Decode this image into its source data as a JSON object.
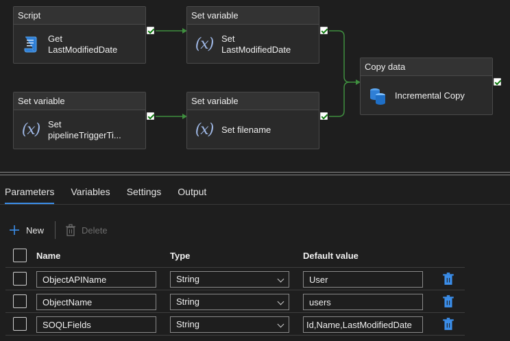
{
  "canvas": {
    "activities": [
      {
        "id": "script",
        "header": "Script",
        "label": "Get\nLastModifiedDate",
        "icon": "script-icon"
      },
      {
        "id": "setvar1",
        "header": "Set variable",
        "label": "Set\nLastModifiedDate",
        "icon": "variable-icon"
      },
      {
        "id": "setvar2",
        "header": "Set variable",
        "label": "Set\npipelineTriggerTi...",
        "icon": "variable-icon"
      },
      {
        "id": "setvar3",
        "header": "Set variable",
        "label": "Set filename",
        "icon": "variable-icon"
      },
      {
        "id": "copy",
        "header": "Copy data",
        "label": "Incremental Copy",
        "icon": "copy-data-icon"
      }
    ],
    "success_color": "#3f8f3f",
    "variable_glyph": "(𝑥)"
  },
  "tabs": [
    {
      "label": "Parameters",
      "active": true
    },
    {
      "label": "Variables",
      "active": false
    },
    {
      "label": "Settings",
      "active": false
    },
    {
      "label": "Output",
      "active": false
    }
  ],
  "toolbar": {
    "new_label": "New",
    "delete_label": "Delete"
  },
  "table": {
    "headers": {
      "name": "Name",
      "type": "Type",
      "default": "Default value"
    },
    "rows": [
      {
        "name": "ObjectAPIName",
        "type": "String",
        "default": "User"
      },
      {
        "name": "ObjectName",
        "type": "String",
        "default": "users"
      },
      {
        "name": "SOQLFields",
        "type": "String",
        "default": "Id,Name,LastModifiedDate"
      }
    ]
  },
  "colors": {
    "accent": "#3b8eea",
    "trash": "#3b8eea"
  }
}
